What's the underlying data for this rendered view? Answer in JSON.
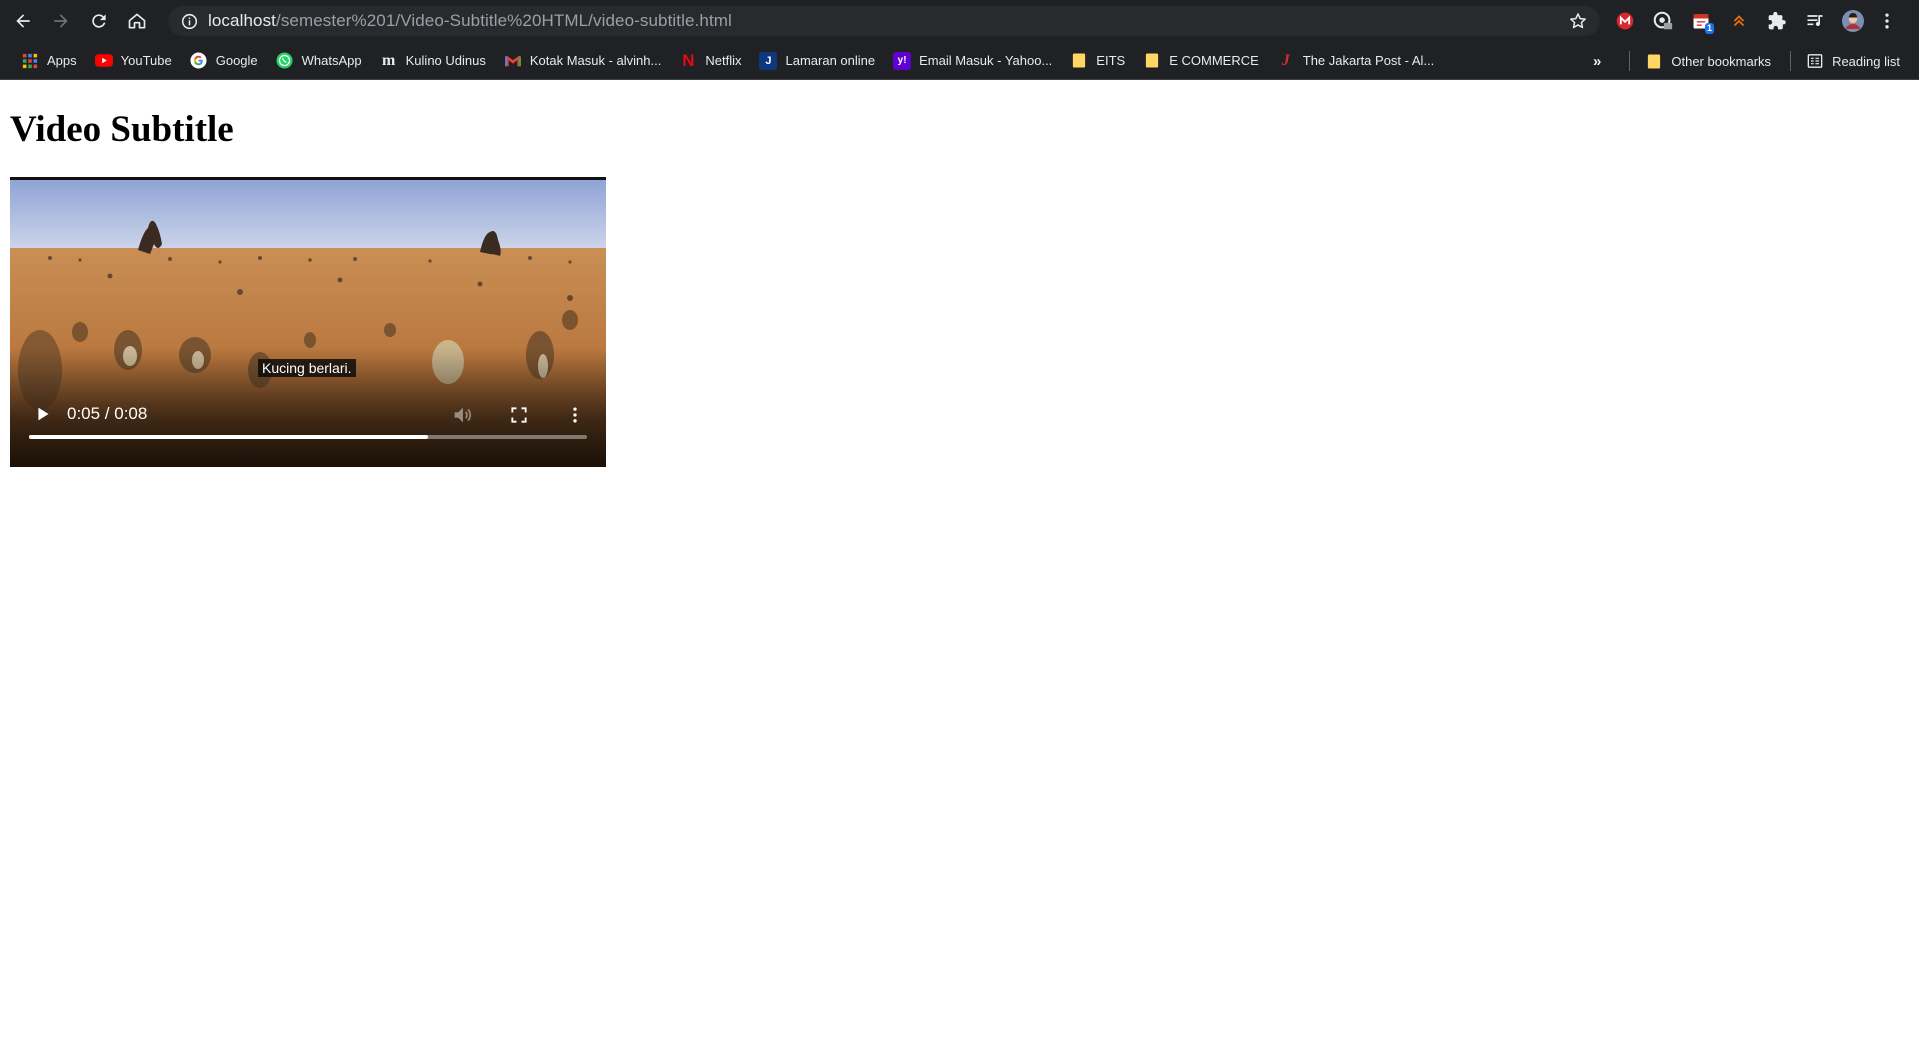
{
  "browser": {
    "url_host": "localhost",
    "url_path": "/semester%201/Video-Subtitle%20HTML/video-subtitle.html",
    "extensions": [
      {
        "name": "mega-extension",
        "color": "#d9272e"
      },
      {
        "name": "vpn-extension",
        "color": "#e8eaed"
      },
      {
        "name": "calendar-extension",
        "color": "#e8eaed",
        "badge": "1"
      },
      {
        "name": "arrows-extension",
        "color": "#e8710a"
      },
      {
        "name": "puzzle-extensions",
        "color": "#e8eaed"
      },
      {
        "name": "media-controls",
        "color": "#e8eaed"
      },
      {
        "name": "profile",
        "color": "#b33"
      }
    ]
  },
  "bookmarks": {
    "items": [
      {
        "label": "Apps",
        "icon": "apps-grid-icon",
        "color": "#4285f4"
      },
      {
        "label": "YouTube",
        "icon": "youtube-icon",
        "color": "#ff0000"
      },
      {
        "label": "Google",
        "icon": "google-icon",
        "color": "#ffffff"
      },
      {
        "label": "WhatsApp",
        "icon": "whatsapp-icon",
        "color": "#25d366"
      },
      {
        "label": "Kulino Udinus",
        "icon": "kulino-icon",
        "color": "#e8eaed"
      },
      {
        "label": "Kotak Masuk - alvinh...",
        "icon": "gmail-icon",
        "color": "#ea4335"
      },
      {
        "label": "Netflix",
        "icon": "netflix-icon",
        "color": "#e50914"
      },
      {
        "label": "Lamaran online",
        "icon": "jobstreet-icon",
        "color": "#0d3880"
      },
      {
        "label": "Email Masuk - Yahoo...",
        "icon": "yahoo-icon",
        "color": "#6001d2"
      },
      {
        "label": "EITS",
        "icon": "folder-icon",
        "color": "#fdd663"
      },
      {
        "label": "E COMMERCE",
        "icon": "folder-icon",
        "color": "#fdd663"
      },
      {
        "label": "The Jakarta Post - Al...",
        "icon": "jakarta-post-icon",
        "color": "#d32f2f"
      }
    ],
    "overflow": "»",
    "other": "Other bookmarks",
    "reading_list": "Reading list"
  },
  "page": {
    "title": "Video Subtitle"
  },
  "video": {
    "caption": "Kucing berlari.",
    "time": "0:05 / 0:08",
    "progress": 0.715
  }
}
